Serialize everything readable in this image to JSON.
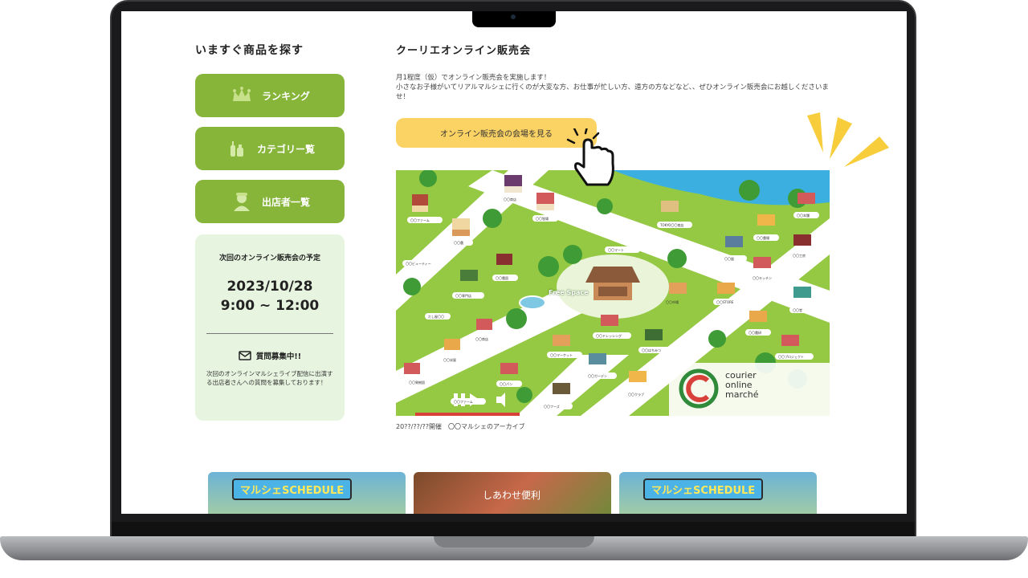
{
  "sidebar": {
    "title": "いますぐ商品を探す",
    "buttons": [
      {
        "label": "ランキング",
        "icon": "crown-icon"
      },
      {
        "label": "カテゴリー覧",
        "icon": "bottles-icon"
      },
      {
        "label": "出店者一覧",
        "icon": "person-icon"
      }
    ],
    "next_event": {
      "title": "次回のオンライン販売会の予定",
      "date": "2023/10/28",
      "time": "9:00 ~ 12:00",
      "question_title": "質問募集中!!",
      "question_text": "次回のオンラインマルシェライブ配信に出演する出店者さんへの質問を募集しております！"
    }
  },
  "main": {
    "title": "クーリエオンライン販売会",
    "description_line1": "月1程度（仮）でオンライン販売会を実施します！",
    "description_line2": "小さなお子様がいてリアルマルシェに行くのが大変な方、お仕事が忙しい方、遠方の方などなど、、ぜひオンライン販売会にお越しくださいませ！",
    "cta_label": "オンライン販売会の会場を見る",
    "map": {
      "center_label": "Free Space",
      "logo_line1": "courier",
      "logo_line2": "online",
      "logo_line3": "marché",
      "stall_labels": [
        "〇〇ファーム",
        "〇〇商店",
        "〇〇牧場",
        "〇〇農",
        "〇〇ビューティー",
        "〇〇農園",
        "〇〇専門店",
        "だし屋〇〇",
        "〇〇商店",
        "〇〇米屋",
        "〇〇マーケット",
        "〇〇ドレッシング",
        "〇〇はちみつ",
        "〇〇ガーデン",
        "〇〇クラブ",
        "〇〇パン",
        "〇〇ファーム",
        "〇〇フーズ",
        "〇〇マート",
        "TOKYO〇〇商店",
        "〇〇本舗",
        "〇〇農場",
        "〇〇工房",
        "〇〇屋",
        "〇〇キッチン",
        "〇〇STORE",
        "〇〇堂",
        "〇〇農研",
        "〇〇プロジェクト",
        "〇〇果樹園",
        "〇〇市場"
      ]
    },
    "caption": "20??/??/??開催　〇〇マルシェのアーカイブ"
  },
  "banners": [
    {
      "label": "マルシェSCHEDULE"
    },
    {
      "label": "しあわせ便利"
    },
    {
      "label": "マルシェSCHEDULE"
    }
  ],
  "colors": {
    "accent_green": "#86b53a",
    "cta_yellow": "#fbd264",
    "panel_green": "#e7f5e0",
    "map_green": "#8fc63f"
  }
}
